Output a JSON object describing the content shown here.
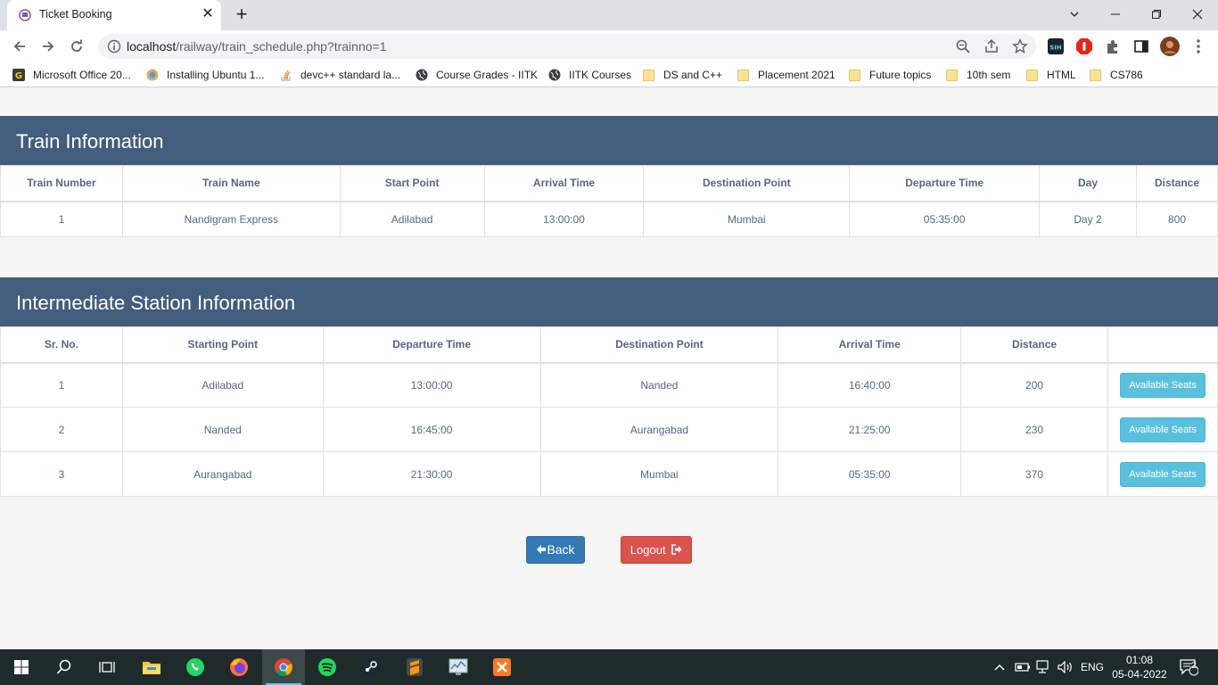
{
  "browser": {
    "tab_title": "Ticket Booking",
    "tab_close": "✕",
    "new_tab": "+",
    "url_host": "localhost",
    "url_path": "/railway/train_schedule.php?trainno=1",
    "bookmarks": [
      {
        "label": "Microsoft Office 20...",
        "icon": "g-icon"
      },
      {
        "label": "Installing Ubuntu 1...",
        "icon": "ubuntu-icon"
      },
      {
        "label": "devc++ standard la...",
        "icon": "stackoverflow-icon"
      },
      {
        "label": "Course Grades - IITK",
        "icon": "globe-icon"
      },
      {
        "label": "IITK Courses",
        "icon": "globe-icon"
      },
      {
        "label": "DS and C++",
        "icon": "folder-icon"
      },
      {
        "label": "Placement 2021",
        "icon": "folder-icon"
      },
      {
        "label": "Future topics",
        "icon": "folder-icon"
      },
      {
        "label": "10th sem",
        "icon": "folder-icon"
      },
      {
        "label": "HTML",
        "icon": "folder-icon"
      },
      {
        "label": "CS786",
        "icon": "folder-icon"
      }
    ]
  },
  "train_info": {
    "title": "Train Information",
    "headers": [
      "Train Number",
      "Train Name",
      "Start Point",
      "Arrival Time",
      "Destination Point",
      "Departure Time",
      "Day",
      "Distance"
    ],
    "row": [
      "1",
      "Nandigram Express",
      "Adilabad",
      "13:00:00",
      "Mumbai",
      "05:35:00",
      "Day 2",
      "800"
    ]
  },
  "intermediate": {
    "title": "Intermediate Station Information",
    "headers": [
      "Sr. No.",
      "Starting Point",
      "Departure Time",
      "Destination Point",
      "Arrival Time",
      "Distance",
      ""
    ],
    "rows": [
      [
        "1",
        "Adilabad",
        "13:00:00",
        "Nanded",
        "16:40:00",
        "200"
      ],
      [
        "2",
        "Nanded",
        "16:45:00",
        "Aurangabad",
        "21:25:00",
        "230"
      ],
      [
        "3",
        "Aurangabad",
        "21:30:00",
        "Mumbai",
        "05:35:00",
        "370"
      ]
    ],
    "seats_button": "Available Seats"
  },
  "actions": {
    "back": "Back",
    "logout": "Logout"
  },
  "taskbar": {
    "lang": "ENG",
    "time": "01:08",
    "date": "05-04-2022",
    "notifications": "2"
  },
  "colors": {
    "header": "#435d7d",
    "info_button": "#5bc0de",
    "primary_button": "#337ab7",
    "danger_button": "#d9534f",
    "text": "#566787"
  }
}
